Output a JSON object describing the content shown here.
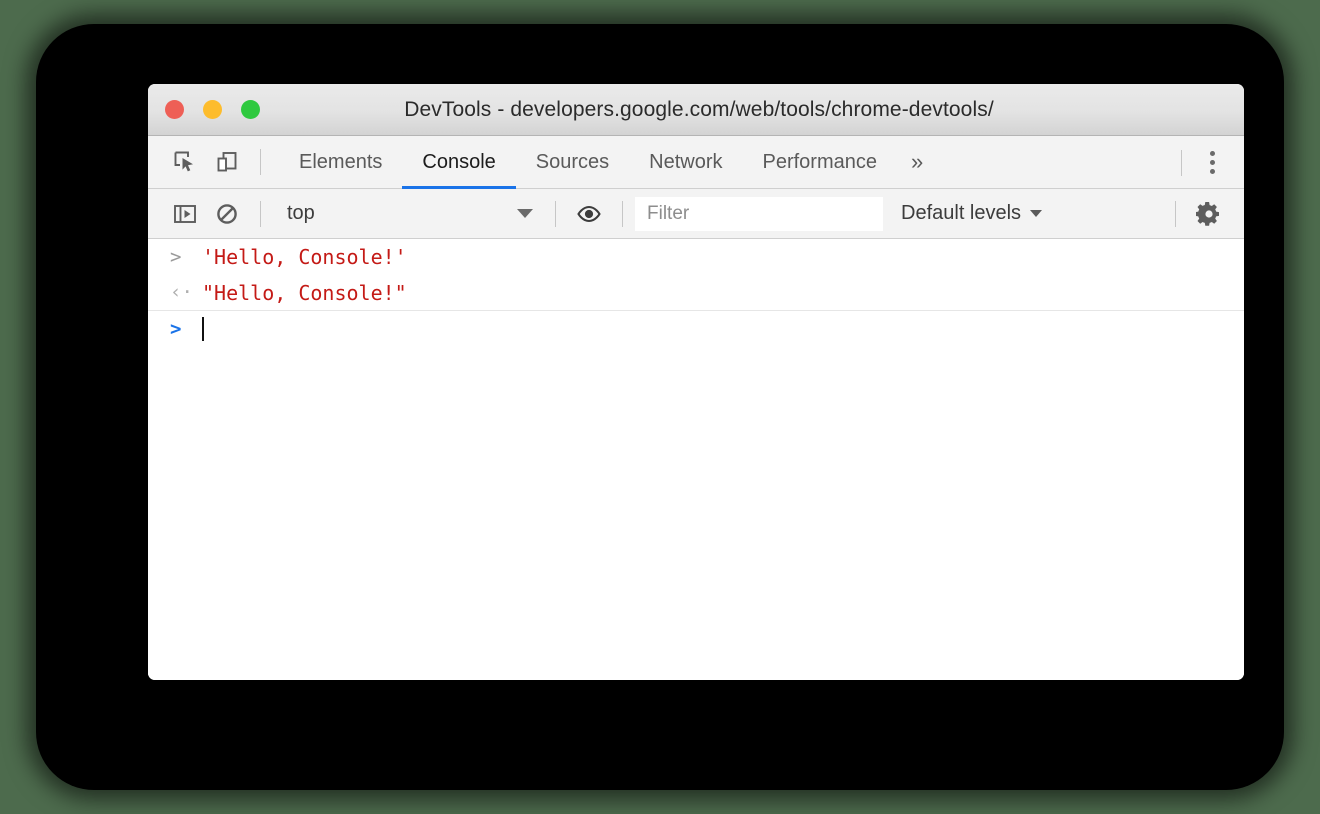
{
  "window": {
    "title": "DevTools - developers.google.com/web/tools/chrome-devtools/",
    "traffic_lights": [
      {
        "name": "close",
        "color": "#ee5f56"
      },
      {
        "name": "minimize",
        "color": "#fdbc2c"
      },
      {
        "name": "maximize",
        "color": "#2fc93f"
      }
    ]
  },
  "toolbar": {
    "inspect_icon": "inspect-element-icon",
    "device_icon": "device-toolbar-icon",
    "more_tabs_label": "»",
    "menu_icon": "more-vertical-icon"
  },
  "tabs": [
    {
      "label": "Elements",
      "active": false
    },
    {
      "label": "Console",
      "active": true
    },
    {
      "label": "Sources",
      "active": false
    },
    {
      "label": "Network",
      "active": false
    },
    {
      "label": "Performance",
      "active": false
    }
  ],
  "console_toolbar": {
    "sidebar_icon": "show-console-sidebar-icon",
    "clear_icon": "clear-console-icon",
    "context": "top",
    "eye_icon": "create-live-expression-icon",
    "filter_placeholder": "Filter",
    "filter_value": "",
    "levels_label": "Default levels",
    "settings_icon": "settings-gear-icon"
  },
  "console_rows": [
    {
      "type": "input",
      "gutter": ">",
      "text": "'Hello, Console!'"
    },
    {
      "type": "result",
      "gutter": "‹·",
      "text": "\"Hello, Console!\""
    },
    {
      "type": "prompt",
      "gutter": ">",
      "text": ""
    }
  ],
  "colors": {
    "accent": "#1a73e8",
    "console_string": "#c41a16",
    "backdrop": "#4d6b4d"
  }
}
